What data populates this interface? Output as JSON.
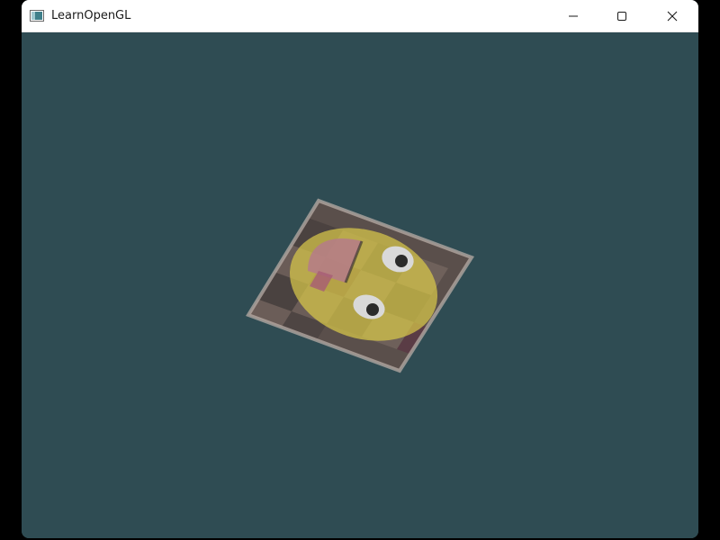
{
  "window": {
    "title": "LearnOpenGL",
    "buttons": {
      "minimize_icon": "minimize-icon",
      "maximize_icon": "maximize-icon",
      "close_icon": "close-icon"
    }
  },
  "scene": {
    "clear_color": "#2f4c53",
    "plane": {
      "textures": [
        "brick-wall-container",
        "awesome-face"
      ],
      "face_color": "#d8c84a",
      "tile_colors": [
        "#4d4340",
        "#6a5c58",
        "#8b7b76",
        "#5a3c45"
      ]
    }
  }
}
